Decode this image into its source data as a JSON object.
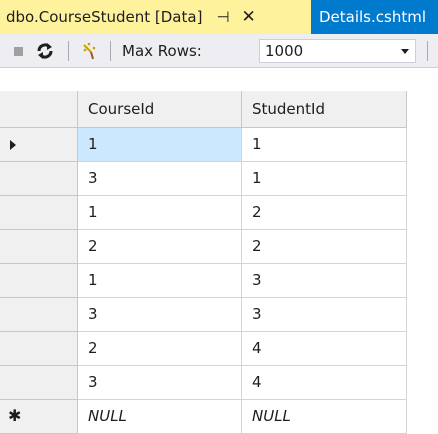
{
  "tabs": {
    "active": {
      "title": "dbo.CourseStudent [Data]",
      "pin_glyph": "⊣",
      "close_glyph": "✕"
    },
    "inactive": {
      "title": "Details.cshtml"
    }
  },
  "toolbar": {
    "icons": [
      "stop-icon",
      "refresh-icon",
      "filter-icon"
    ],
    "max_rows_label": "Max Rows:",
    "max_rows_value": "1000"
  },
  "grid": {
    "columns": [
      "CourseId",
      "StudentId"
    ],
    "rows": [
      {
        "course_id": "1",
        "student_id": "1",
        "current": true
      },
      {
        "course_id": "3",
        "student_id": "1",
        "current": false
      },
      {
        "course_id": "1",
        "student_id": "2",
        "current": false
      },
      {
        "course_id": "2",
        "student_id": "2",
        "current": false
      },
      {
        "course_id": "1",
        "student_id": "3",
        "current": false
      },
      {
        "course_id": "3",
        "student_id": "3",
        "current": false
      },
      {
        "course_id": "2",
        "student_id": "4",
        "current": false
      },
      {
        "course_id": "3",
        "student_id": "4",
        "current": false
      }
    ],
    "new_row": {
      "indicator": "✱",
      "course_id": "NULL",
      "student_id": "NULL"
    }
  },
  "colors": {
    "active_tab": "#fff29d",
    "inactive_tab": "#007acc",
    "selected_cell": "#cce8ff"
  }
}
